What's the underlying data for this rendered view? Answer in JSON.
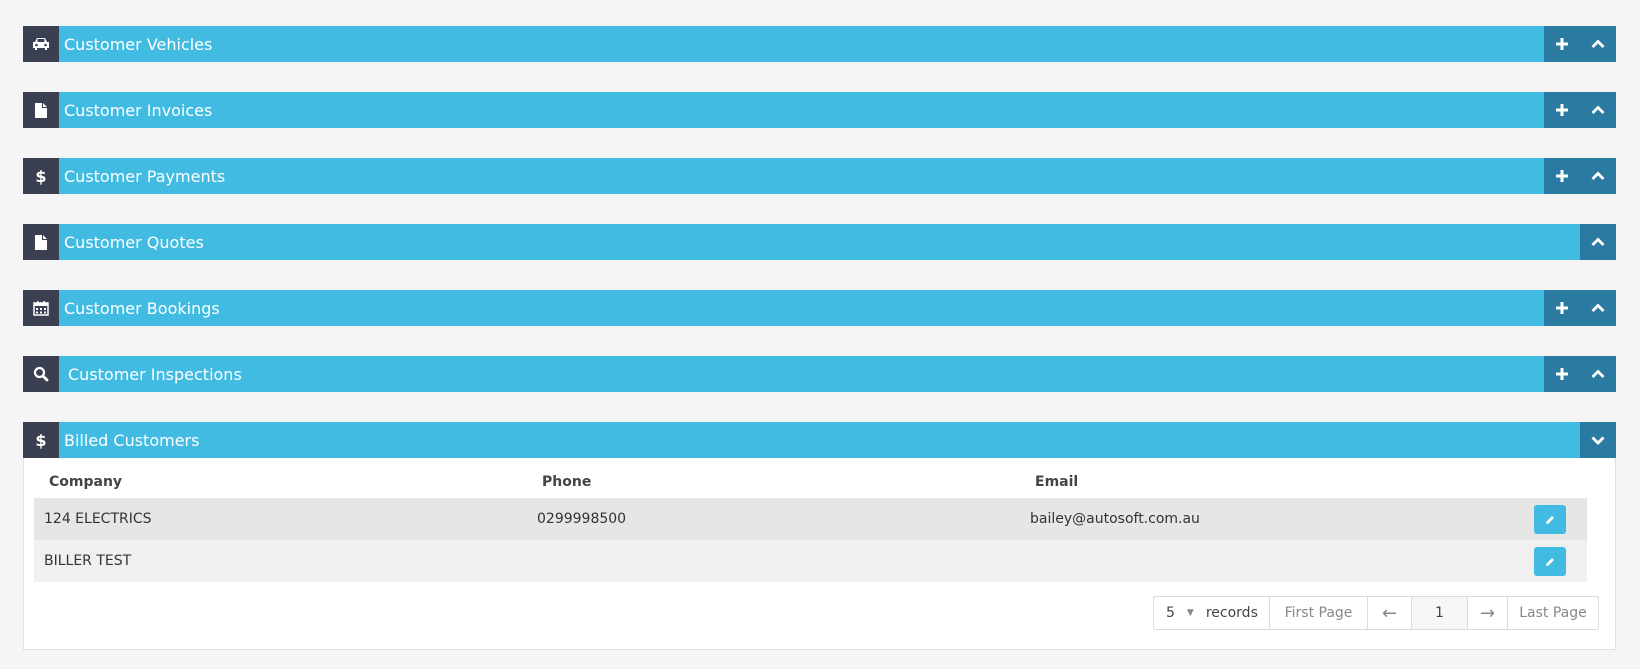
{
  "panels": [
    {
      "title": "Customer Vehicles",
      "icon": "car-icon",
      "has_add": true,
      "toggle": "chevron-up"
    },
    {
      "title": "Customer Invoices",
      "icon": "file-icon",
      "has_add": true,
      "toggle": "chevron-up"
    },
    {
      "title": "Customer Payments",
      "icon": "dollar-icon",
      "has_add": true,
      "toggle": "chevron-up"
    },
    {
      "title": "Customer Quotes",
      "icon": "file-icon",
      "has_add": false,
      "toggle": "chevron-up"
    },
    {
      "title": "Customer Bookings",
      "icon": "calendar-icon",
      "has_add": true,
      "toggle": "chevron-up"
    },
    {
      "title": "Customer Inspections",
      "icon": "search-icon",
      "has_add": true,
      "toggle": "chevron-up"
    },
    {
      "title": "Billed Customers",
      "icon": "dollar-icon",
      "has_add": false,
      "toggle": "chevron-down"
    }
  ],
  "billed": {
    "columns": [
      "Company",
      "Phone",
      "Email"
    ],
    "rows": [
      {
        "company": "124 ELECTRICS",
        "phone": "0299998500",
        "email": "bailey@autosoft.com.au"
      },
      {
        "company": "BILLER TEST",
        "phone": "",
        "email": ""
      }
    ],
    "pager": {
      "page_size": "5",
      "records_label": "records",
      "first": "First Page",
      "prev": "←",
      "page": "1",
      "next": "→",
      "last": "Last Page"
    }
  },
  "colors": {
    "header_bg": "#41bbe1",
    "icon_bg": "#3a3f51",
    "button_bg": "#2a7aa2",
    "edit_bg": "#41bbe1"
  }
}
